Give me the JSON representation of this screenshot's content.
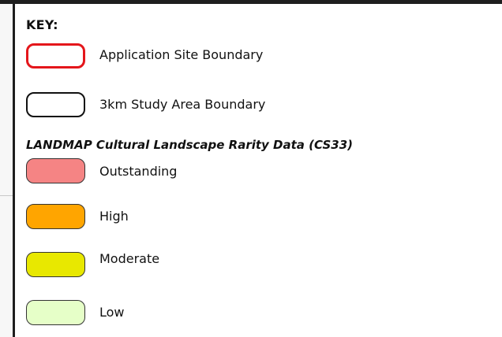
{
  "legend": {
    "key_title": "KEY:",
    "boundaries": [
      {
        "label": "Application Site Boundary",
        "stroke_color": "#e4161b"
      },
      {
        "label": "3km Study Area Boundary",
        "stroke_color": "#111111"
      }
    ],
    "section_title": "LANDMAP Cultural Landscape Rarity Data (CS33)",
    "categories": [
      {
        "label": "Outstanding",
        "fill_color": "#f58484"
      },
      {
        "label": "High",
        "fill_color": "#ffa500"
      },
      {
        "label": "Moderate",
        "fill_color": "#e8e800"
      },
      {
        "label": "Low",
        "fill_color": "#e6ffc8"
      }
    ]
  }
}
